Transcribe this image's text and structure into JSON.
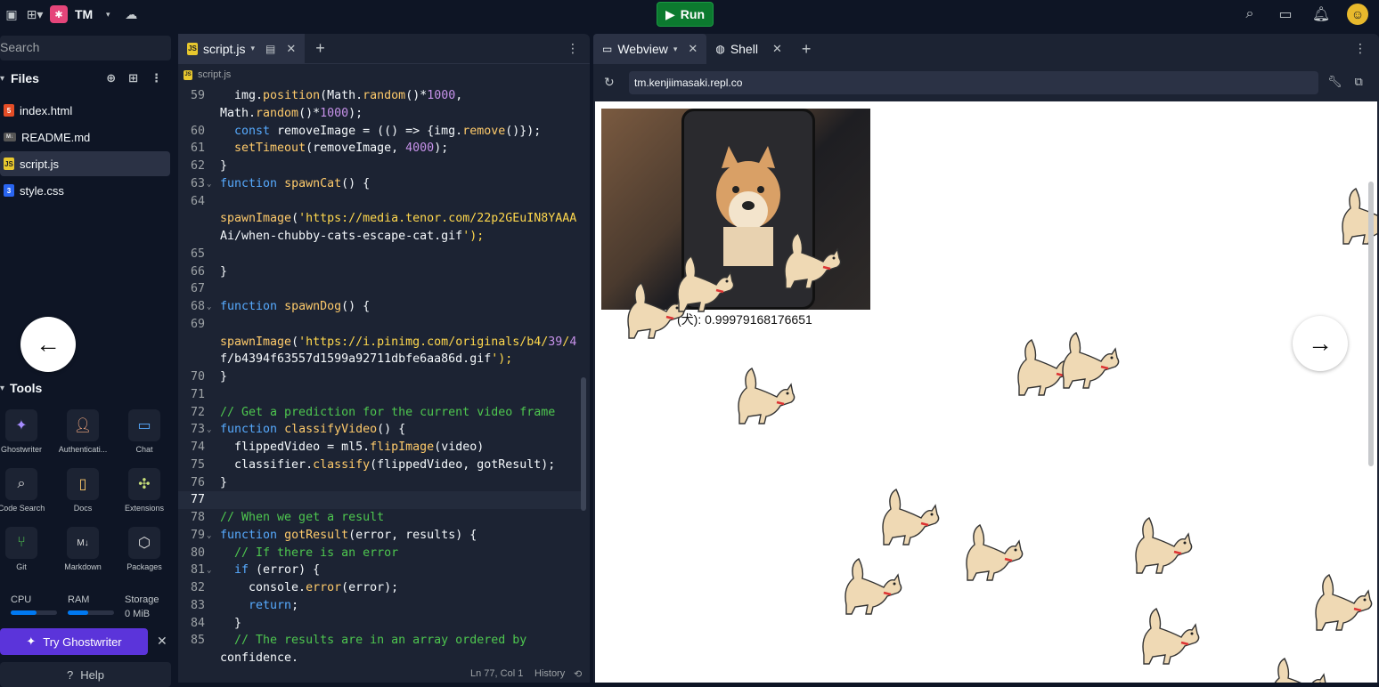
{
  "topbar": {
    "workspace": "TM",
    "run_label": "Run"
  },
  "sidebar": {
    "search_placeholder": "Search",
    "files_title": "Files",
    "files": [
      {
        "name": "index.html",
        "type": "html"
      },
      {
        "name": "README.md",
        "type": "md"
      },
      {
        "name": "script.js",
        "type": "js",
        "active": true
      },
      {
        "name": "style.css",
        "type": "css"
      }
    ],
    "tools_title": "Tools",
    "tools": [
      {
        "label": "Ghostwriter",
        "icon": "ghostwriter-icon"
      },
      {
        "label": "Authenticati...",
        "icon": "user-icon"
      },
      {
        "label": "Chat",
        "icon": "chat-icon"
      },
      {
        "label": "Code Search",
        "icon": "search-icon"
      },
      {
        "label": "Docs",
        "icon": "book-icon"
      },
      {
        "label": "Extensions",
        "icon": "puzzle-icon"
      },
      {
        "label": "Git",
        "icon": "git-icon"
      },
      {
        "label": "Markdown",
        "icon": "markdown-icon"
      },
      {
        "label": "Packages",
        "icon": "cube-icon"
      }
    ],
    "usage": {
      "cpu_label": "CPU",
      "ram_label": "RAM",
      "storage_label": "Storage",
      "storage_value": "0 MiB",
      "cpu_fraction": 0.55,
      "ram_fraction": 0.45
    },
    "ghostwriter_button": "Try Ghostwriter",
    "help_label": "Help"
  },
  "editor": {
    "tab_label": "script.js",
    "breadcrumb": "script.js",
    "lines": [
      {
        "n": "59",
        "html": "  img.position(Math.random()*1000,"
      },
      {
        "n": "",
        "html": "Math.random()*1000);"
      },
      {
        "n": "60",
        "html": "  const removeImage = (() => {img.remove()});"
      },
      {
        "n": "61",
        "html": "  setTimeout(removeImage, 4000);"
      },
      {
        "n": "62",
        "html": "}"
      },
      {
        "n": "63",
        "html": "function spawnCat() {",
        "fold": true
      },
      {
        "n": "64",
        "html": ""
      },
      {
        "n": "",
        "html": "spawnImage('https://media.tenor.com/22p2GEuIN8YAAA"
      },
      {
        "n": "",
        "html": "Ai/when-chubby-cats-escape-cat.gif');"
      },
      {
        "n": "65",
        "html": ""
      },
      {
        "n": "66",
        "html": "}"
      },
      {
        "n": "67",
        "html": ""
      },
      {
        "n": "68",
        "html": "function spawnDog() {",
        "fold": true
      },
      {
        "n": "69",
        "html": ""
      },
      {
        "n": "",
        "html": "spawnImage('https://i.pinimg.com/originals/b4/39/4"
      },
      {
        "n": "",
        "html": "f/b4394f63557d1599a92711dbfe6aa86d.gif');"
      },
      {
        "n": "70",
        "html": "}"
      },
      {
        "n": "71",
        "html": ""
      },
      {
        "n": "72",
        "html": "// Get a prediction for the current video frame"
      },
      {
        "n": "73",
        "html": "function classifyVideo() {",
        "fold": true
      },
      {
        "n": "74",
        "html": "  flippedVideo = ml5.flipImage(video)"
      },
      {
        "n": "75",
        "html": "  classifier.classify(flippedVideo, gotResult);"
      },
      {
        "n": "76",
        "html": "}"
      },
      {
        "n": "77",
        "html": "",
        "current": true
      },
      {
        "n": "78",
        "html": "// When we get a result"
      },
      {
        "n": "79",
        "html": "function gotResult(error, results) {",
        "fold": true
      },
      {
        "n": "80",
        "html": "  // If there is an error"
      },
      {
        "n": "81",
        "html": "  if (error) {",
        "fold": true
      },
      {
        "n": "82",
        "html": "    console.error(error);"
      },
      {
        "n": "83",
        "html": "    return;"
      },
      {
        "n": "84",
        "html": "  }"
      },
      {
        "n": "85",
        "html": "  // The results are in an array ordered by"
      },
      {
        "n": "",
        "html": "confidence."
      }
    ],
    "status_position": "Ln 77, Col 1",
    "status_history": "History"
  },
  "webview": {
    "tab_webview": "Webview",
    "tab_shell": "Shell",
    "url": "tm.kenjiimasaki.repl.co",
    "prediction_text": "(犬): 0.99979168176651"
  },
  "colors": {
    "run_green": "#0c7a2f",
    "ghostwriter_purple": "#5b34da",
    "accent_blue": "#0079f2"
  }
}
